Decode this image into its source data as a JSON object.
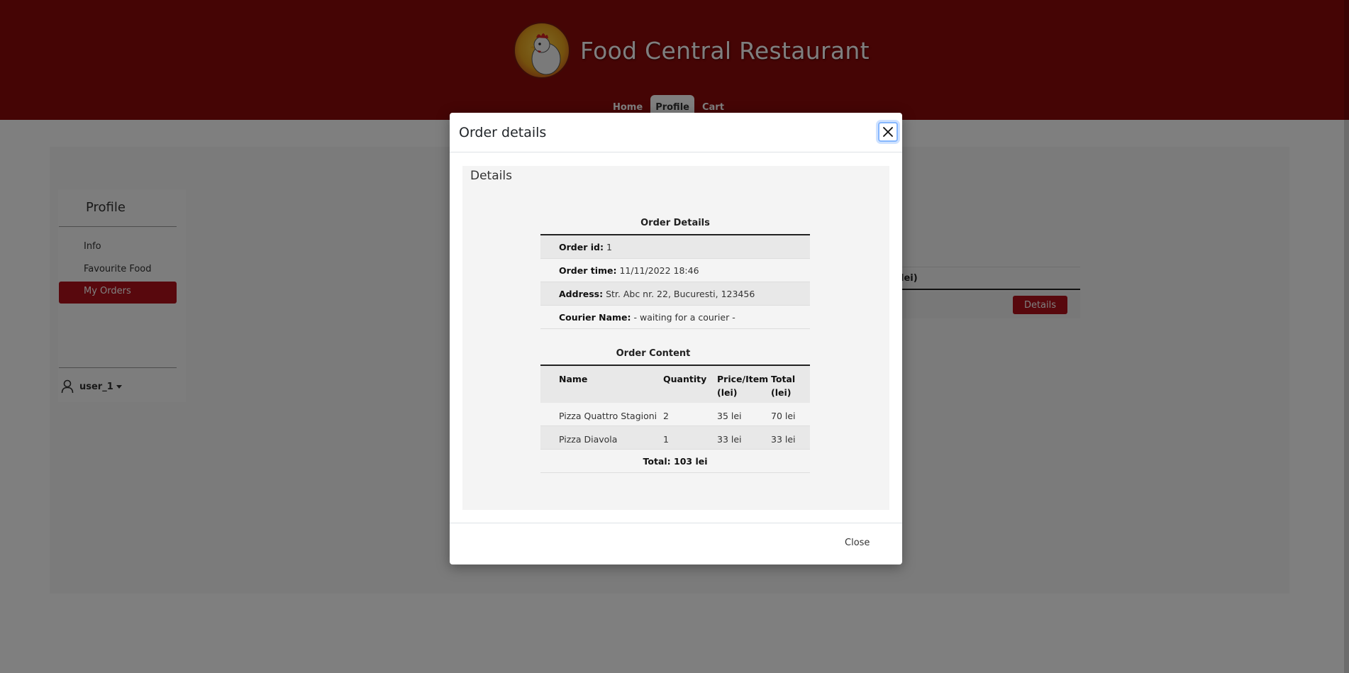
{
  "header": {
    "brand_name": "Food Central Restaurant",
    "nav": [
      {
        "label": "Home"
      },
      {
        "label": "Profile",
        "active": true
      },
      {
        "label": "Cart"
      }
    ]
  },
  "sidebar": {
    "title": "Profile",
    "items": [
      {
        "label": "Info"
      },
      {
        "label": "Favourite Food"
      },
      {
        "label": "My Orders",
        "active": true
      }
    ],
    "user": "user_1"
  },
  "orders_table": {
    "partial_header": "lei)",
    "details_button": "Details"
  },
  "modal": {
    "title": "Order details",
    "panel_heading": "Details",
    "order_details": {
      "caption": "Order Details",
      "rows": [
        {
          "label": "Order id:",
          "value": "1"
        },
        {
          "label": "Order time:",
          "value": "11/11/2022 18:46"
        },
        {
          "label": "Address:",
          "value": "Str. Abc nr. 22, Bucuresti, 123456"
        },
        {
          "label": "Courier Name:",
          "value": "- waiting for a courier -"
        }
      ]
    },
    "order_content": {
      "caption": "Order Content",
      "columns": [
        "Name",
        "Quantity",
        "Price/Item (lei)",
        "Total (lei)"
      ],
      "rows": [
        [
          "Pizza Quattro Stagioni",
          "2",
          "35 lei",
          "70 lei"
        ],
        [
          "Pizza Diavola",
          "1",
          "33 lei",
          "33 lei"
        ]
      ],
      "total": "Total: 103 lei"
    },
    "footer_close": "Close"
  },
  "colors": {
    "brand_red": "#8a0a0a",
    "accent_red": "#b0111a"
  }
}
